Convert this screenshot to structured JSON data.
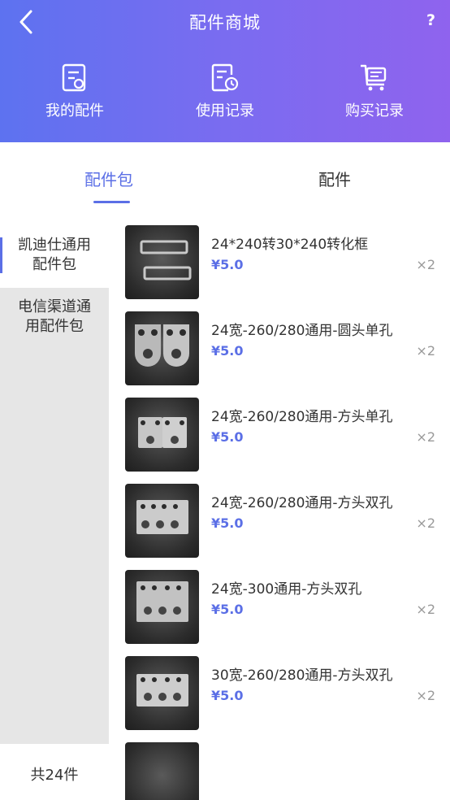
{
  "header": {
    "title": "配件商城",
    "help": "?"
  },
  "quick_links": [
    {
      "label": "我的配件",
      "icon": "my-parts-icon"
    },
    {
      "label": "使用记录",
      "icon": "usage-record-icon"
    },
    {
      "label": "购买记录",
      "icon": "purchase-record-icon"
    }
  ],
  "tabs": [
    {
      "label": "配件包",
      "active": true
    },
    {
      "label": "配件",
      "active": false
    }
  ],
  "sidebar": {
    "items": [
      {
        "label": "凯迪仕通用配件包",
        "active": true
      },
      {
        "label": "电信渠道通用配件包",
        "active": false
      }
    ],
    "total": "共24件"
  },
  "products": [
    {
      "name": "24*240转30*240转化框",
      "price": "¥5.0",
      "qty": "×2",
      "image": "frame"
    },
    {
      "name": "24宽-260/280通用-圆头单孔",
      "price": "¥5.0",
      "qty": "×2",
      "image": "round-single"
    },
    {
      "name": "24宽-260/280通用-方头单孔",
      "price": "¥5.0",
      "qty": "×2",
      "image": "square-single"
    },
    {
      "name": "24宽-260/280通用-方头双孔",
      "price": "¥5.0",
      "qty": "×2",
      "image": "square-double"
    },
    {
      "name": "24宽-300通用-方头双孔",
      "price": "¥5.0",
      "qty": "×2",
      "image": "square-double"
    },
    {
      "name": "30宽-260/280通用-方头双孔",
      "price": "¥5.0",
      "qty": "×2",
      "image": "square-double"
    }
  ],
  "colors": {
    "accent": "#5b6fe6",
    "header_gradient_start": "#5d72f0",
    "header_gradient_end": "#8f63ee"
  }
}
